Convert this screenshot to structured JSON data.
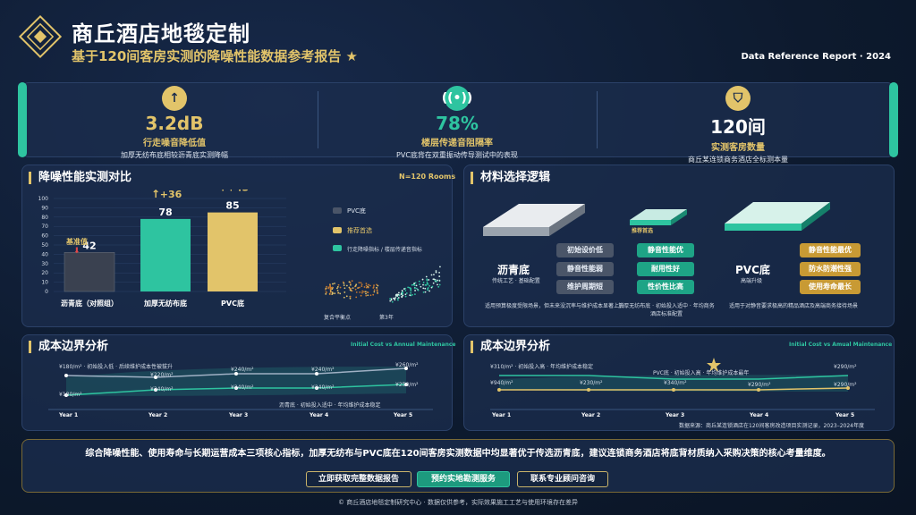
{
  "header": {
    "title": "商丘酒店地毯定制",
    "subtitle": "基于120间客房实测的降噪性能数据参考报告 ★",
    "report_tag": "Data Reference Report · 2024"
  },
  "kpis": [
    {
      "icon": "arrow-up-icon",
      "value": "3.2dB",
      "label": "行走噪音降低值",
      "note": "加厚无纺布底相较沥青底实测降幅"
    },
    {
      "icon": "sound-wave-icon",
      "value": "78%",
      "label": "楼层传递音阻隔率",
      "note": "PVC底背在双重振动传导测试中的表现"
    },
    {
      "icon": "shield-icon",
      "value": "120间",
      "label": "实测客房数量",
      "note": "商丘某连锁商务酒店全标测本量"
    }
  ],
  "colors": {
    "teal": "#2ec4a0",
    "gold": "#e2c46a",
    "gray": "#4a5568",
    "panel": "#1b2d4d"
  },
  "noise_panel": {
    "title": "降噪性能实测对比",
    "sample": "N=120 Rooms",
    "baseline_label": "基准值",
    "legend": [
      "PVC底",
      "推荐首选",
      "行走降噪指标 / 楼层传递音指标"
    ],
    "scatter_label": "复合平衡点",
    "scatter_year": "第3年"
  },
  "chart_data": {
    "type": "bar",
    "categories": [
      "沥青底（对照组）",
      "加厚无纺布底",
      "PVC底"
    ],
    "values": [
      42,
      78,
      85
    ],
    "deltas": [
      "",
      "+36",
      "+43"
    ],
    "yticks": [
      0,
      10,
      20,
      30,
      40,
      50,
      60,
      70,
      80,
      90,
      100
    ],
    "ylim": [
      0,
      100
    ]
  },
  "material_panel": {
    "title": "材料选择逻辑",
    "recommend_tag": "推荐首选",
    "asphalt": {
      "name": "沥青底",
      "sub": "传统工艺 · 基础配置",
      "tags": [
        "初始设价低",
        "静音性能弱",
        "维护周期短"
      ],
      "note": "适用预算极度受限场景，但未来没沉率与维护成本显著上升"
    },
    "nonwoven": {
      "tags": [
        "静音性能优",
        "耐用性好",
        "性价性比高"
      ],
      "note": "加厚无纺布底 · 初始投入适中 · 年均商务酒店标准配置"
    },
    "pvc": {
      "name": "PVC底",
      "sub": "高端升级",
      "tags": [
        "静音性能最优",
        "防水防潮性强",
        "使用寿命最长"
      ],
      "note": "适用于对静音要求极高的精品酒店及高端商务接待场景"
    }
  },
  "cost_left": {
    "title": "成本边界分析",
    "subtitle": "Initial Cost vs Annual Maintenance",
    "years": [
      "Year 1",
      "Year 2",
      "Year 3",
      "Year 4",
      "Year 5"
    ],
    "upper_start": "¥180/m² · 初始投入低 · 后续维护成本性被拔升",
    "upper_values": [
      "¥220/m²",
      "¥240/m²",
      "¥240/m²",
      "¥260/m²"
    ],
    "lower_start": "¥180/m²",
    "lower_values": [
      "¥340/m²",
      "¥240/m²",
      "¥240/m²",
      "¥250/m²"
    ],
    "note": "沥青底 · 初始投入适中 · 年均维护成本稳定"
  },
  "cost_right": {
    "title": "成本边界分析",
    "subtitle": "Initial Cost vs Amual Maintenance",
    "years": [
      "Year 1",
      "Year 2",
      "Year 3",
      "Year 4",
      "Year 5"
    ],
    "upper_start": "¥310/m² · 初始投入高 · 年均维护成本稳定",
    "upper_end": "¥290/m²",
    "lower_values": [
      "¥940/m²",
      "¥230/m²",
      "¥340/m²",
      "¥290/m²",
      "¥290/m²"
    ],
    "annotation": "PVC底 · 初始投入高 · 年均维护成本最年",
    "source": "数据来源：商丘某连锁酒店在120间客房改造项目实测记录，2023–2024年度"
  },
  "summary": {
    "text": "综合降噪性能、使用寿命与长期运营成本三项核心指标，加厚无纺布与PVC底在120间客房实测数据中均显著优于传选沥青底，建议连锁商务酒店将底背材质纳入采购决策的核心考量维度。",
    "buttons": [
      "立即获取完整数据报告",
      "预约实地勘测服务",
      "联系专业顾问咨询"
    ]
  },
  "footer": "© 商丘酒店地毯定制研究中心 · 数据仅供参考，实际效果施工工艺与使用环境存在差异"
}
